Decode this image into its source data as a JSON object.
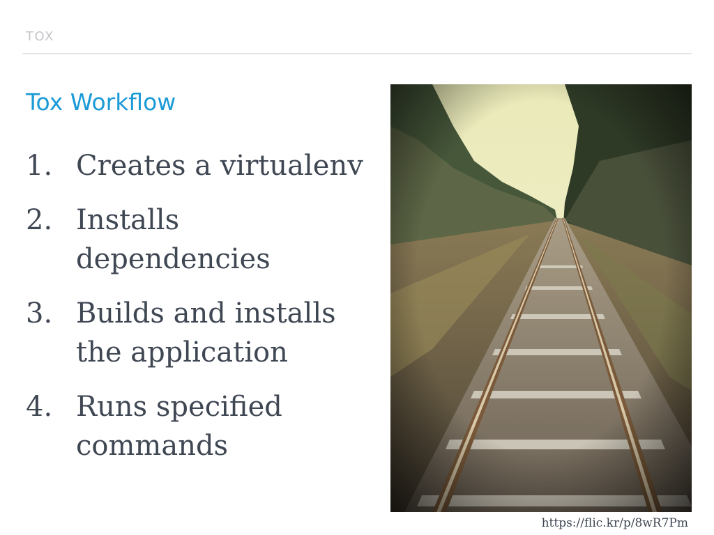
{
  "header": {
    "label": "TOX"
  },
  "slide": {
    "title": "Tox Workflow",
    "steps": [
      {
        "num": "1.",
        "text": "Creates a virtualenv"
      },
      {
        "num": "2.",
        "text": "Installs dependencies"
      },
      {
        "num": "3.",
        "text": "Builds and installs the application"
      },
      {
        "num": "4.",
        "text": "Runs specified commands"
      }
    ]
  },
  "image": {
    "subject": "railway-tracks-photo",
    "credit": "https://flic.kr/p/8wR7Pm"
  },
  "colors": {
    "accent": "#1b9ad6",
    "body_text": "#3f4753",
    "header_text": "#c4c6c9",
    "divider": "#e3e4e6"
  }
}
